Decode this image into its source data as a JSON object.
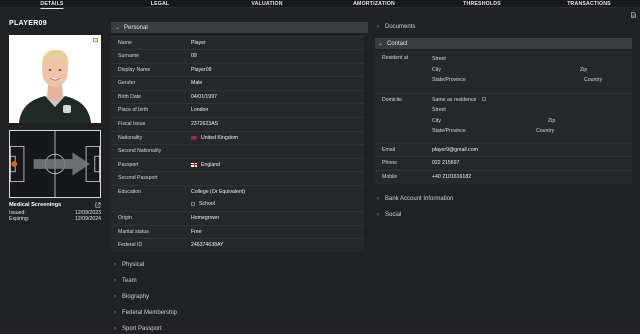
{
  "nav": {
    "tabs": [
      {
        "label": "DETAILS",
        "active": true
      },
      {
        "label": "LEGAL",
        "active": false
      },
      {
        "label": "VALUATION",
        "active": false
      },
      {
        "label": "AMORTIZATION",
        "active": false
      },
      {
        "label": "THRESHOLDS",
        "active": false
      },
      {
        "label": "TRANSACTIONS",
        "active": false
      }
    ]
  },
  "player": {
    "name": "PLAYER09",
    "icons": {
      "photo_badge": "card-icon",
      "corner": "document-icon"
    }
  },
  "medical": {
    "title": "Medical Screenings",
    "issued_label": "Issued:",
    "issued_value": "12/09/2023",
    "expiring_label": "Expiring:",
    "expiring_value": "12/09/2024"
  },
  "personal": {
    "header": "Personal",
    "rows": [
      {
        "label": "Name",
        "value": "Player"
      },
      {
        "label": "Surname",
        "value": "09"
      },
      {
        "label": "Display Name",
        "value": "Player09"
      },
      {
        "label": "Gender",
        "value": "Male"
      },
      {
        "label": "Birth Date",
        "value": "04/01/1997"
      },
      {
        "label": "Place of birth",
        "value": "London"
      },
      {
        "label": "Fiscal Issue",
        "value": "2372623AS"
      },
      {
        "label": "Nationality",
        "value": "United Kingdom"
      },
      {
        "label": "Second Nationality",
        "value": ""
      },
      {
        "label": "Passport",
        "value": "England"
      },
      {
        "label": "Second Passport",
        "value": ""
      },
      {
        "label": "Education",
        "value": "College (Or Equivalent)"
      },
      {
        "label": "",
        "value": "School"
      },
      {
        "label": "Origin",
        "value": "Homegrown"
      },
      {
        "label": "Marital status",
        "value": "Free"
      },
      {
        "label": "Federal ID",
        "value": "246374638AY"
      }
    ]
  },
  "left_sections": [
    "Physical",
    "Team",
    "Biography",
    "Federal Membership",
    "Sport Passport"
  ],
  "right": {
    "documents": "Documents",
    "contact": {
      "header": "Contact",
      "resident_label": "Resident at",
      "street": "Street",
      "city": "City",
      "zip": "Zip",
      "state": "State/Province",
      "country": "Country",
      "domicile_label": "Domicile",
      "same_as_residence": "Same as residence",
      "email_label": "Email",
      "email_value": "player9@gmail.com",
      "phone_label": "Phone",
      "phone_value": "022 215697",
      "mobile_label": "Mobile",
      "mobile_value": "+40 2101616182"
    },
    "bank": "Bank Account Information",
    "social": "Social"
  }
}
